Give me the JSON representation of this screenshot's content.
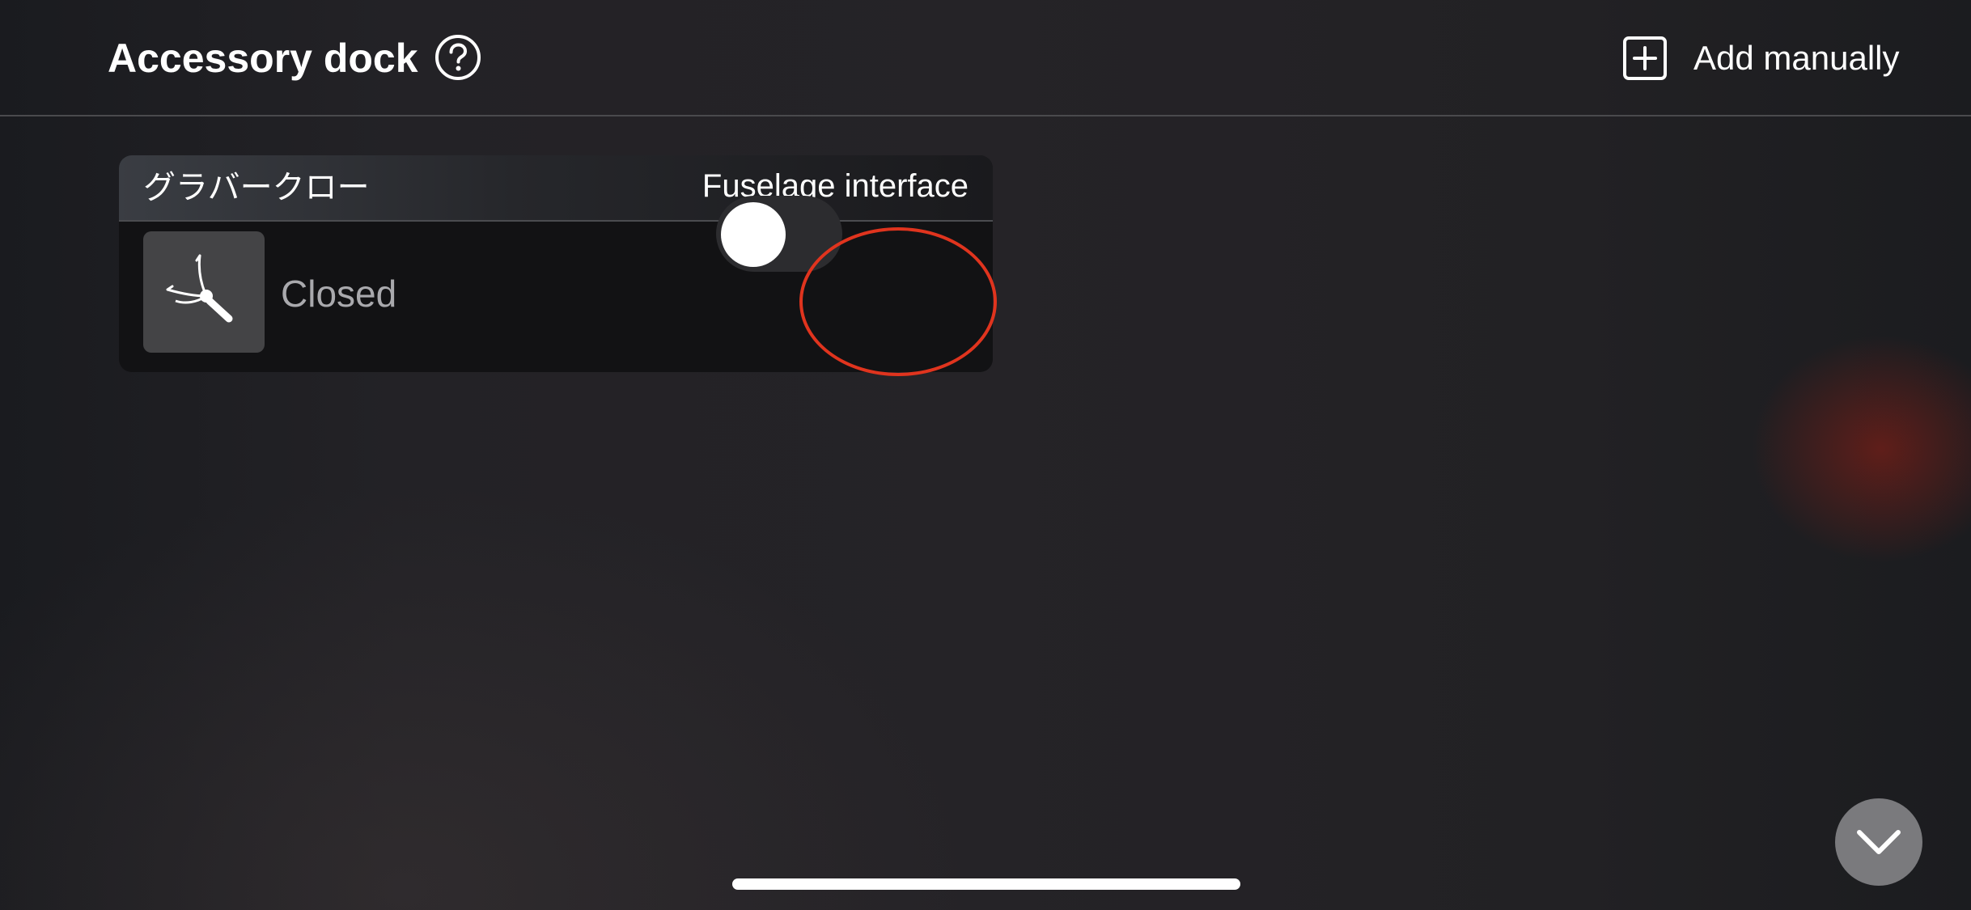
{
  "header": {
    "title": "Accessory dock",
    "help_icon": "question-circle-icon",
    "add_icon": "plus-square-icon",
    "add_label": "Add manually"
  },
  "accessory": {
    "name": "グラバークロー",
    "interface": "Fuselage interface",
    "thumbnail_icon": "grabber-claw-icon",
    "status": "Closed",
    "toggle_on": false
  },
  "annotation": {
    "color": "#e0341e"
  },
  "footer": {
    "collapse_icon": "chevron-down-icon"
  },
  "colors": {
    "background": "#232226",
    "card": "#121214",
    "toggle_track": "#2c2c2f",
    "collapse_button": "#7a7a7d"
  }
}
